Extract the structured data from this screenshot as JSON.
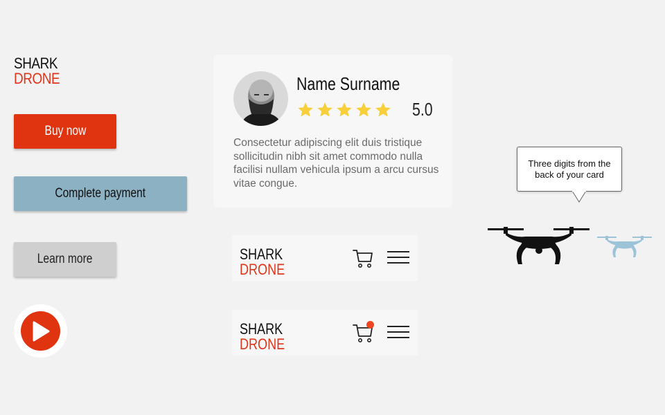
{
  "logo": {
    "line1": "SHARK",
    "line2": "DRONE"
  },
  "buttons": {
    "buy": "Buy now",
    "pay": "Complete payment",
    "learn": "Learn more"
  },
  "review": {
    "name": "Name Surname",
    "rating": "5.0",
    "stars": 5,
    "text": "Consectetur adipiscing elit duis tristique sollicitudin nibh sit amet commodo nulla facilisi nullam vehicula ipsum a arcu cursus vitae congue."
  },
  "nav": [
    {
      "logo_line1": "SHARK",
      "logo_line2": "DRONE",
      "cart_icon": "cart-icon",
      "menu_icon": "hamburger-menu-icon",
      "badge": false
    },
    {
      "logo_line1": "SHARK",
      "logo_line2": "DRONE",
      "cart_icon": "cart-icon",
      "menu_icon": "hamburger-menu-icon",
      "badge": true
    }
  ],
  "tooltip": {
    "text": "Three digits from the back of your card"
  },
  "colors": {
    "brand_red": "#e0330f",
    "steel_blue": "#8bb1c3",
    "gray_button": "#cfcfcf",
    "star_yellow": "#f7cf3b",
    "drone_light": "#9cc3d8"
  }
}
